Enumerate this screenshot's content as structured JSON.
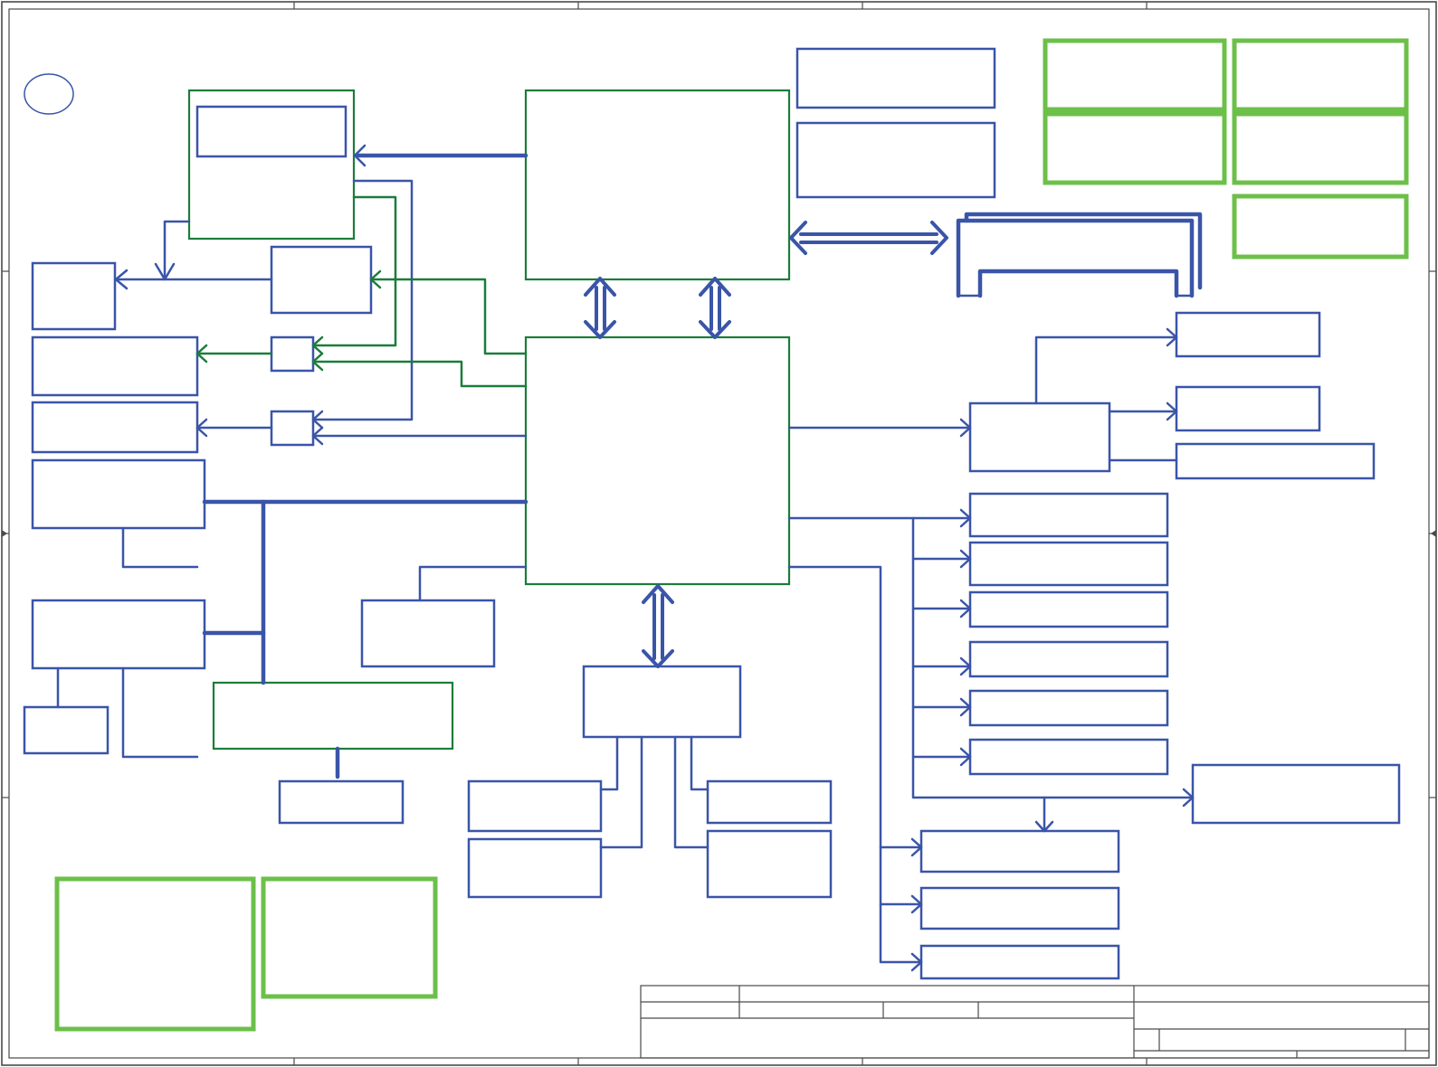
{
  "colors": {
    "block_stroke": "#3a55a8",
    "major_block_stroke": "#1b7d3a",
    "note_block_stroke": "#6cc04a",
    "frame_stroke": "#4a4a4a",
    "background": "#ffffff"
  },
  "icons": {
    "arrow": "open-chevron-arrowhead",
    "bus": "double-line-bidirectional-arrow"
  }
}
